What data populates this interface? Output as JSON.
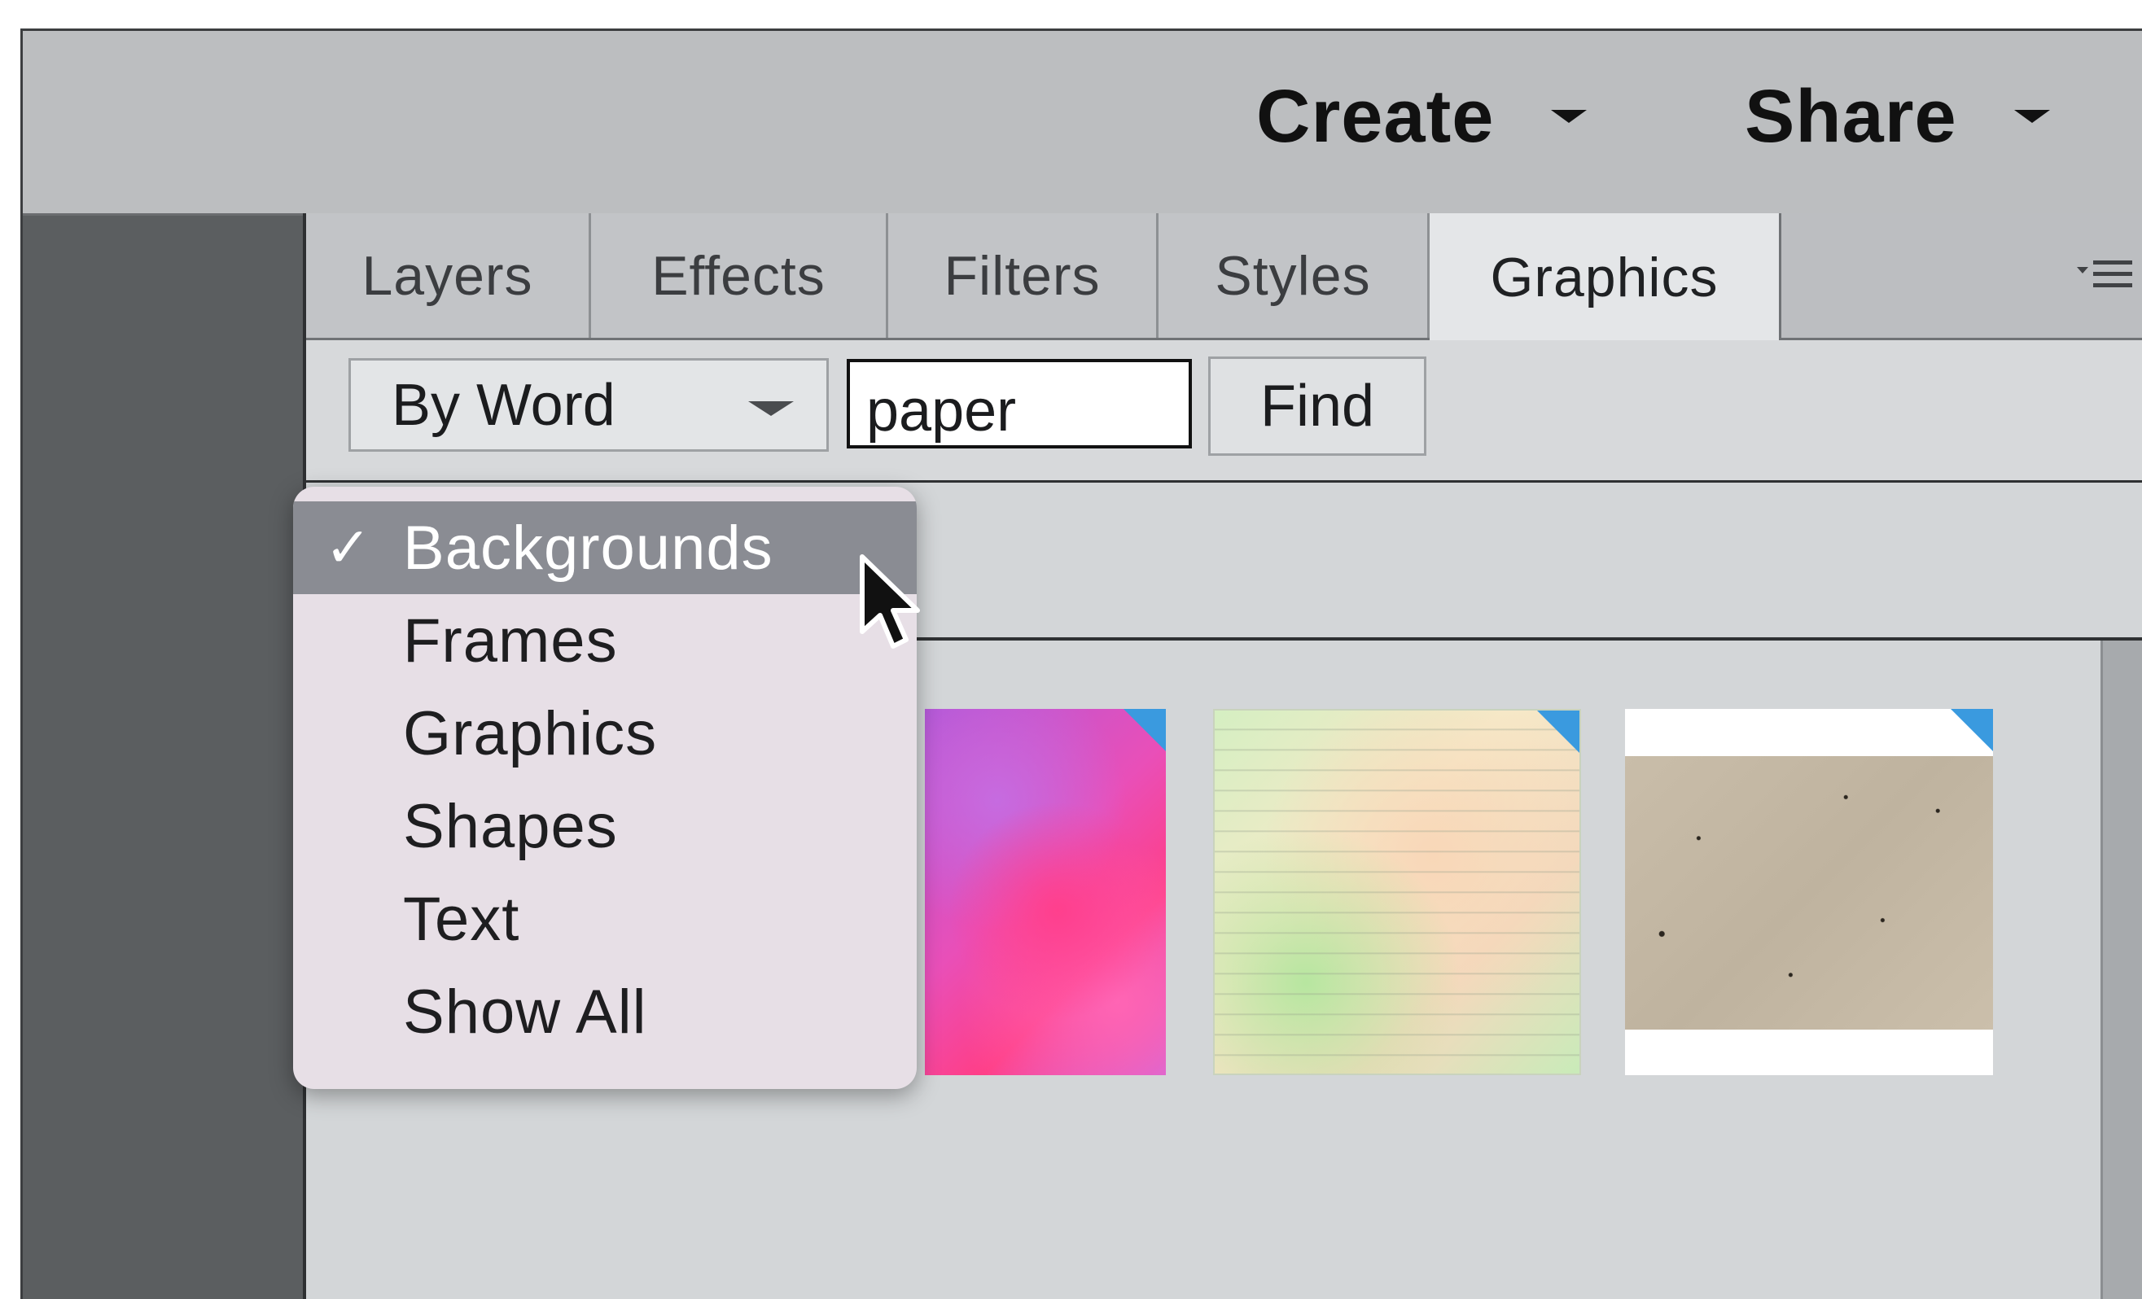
{
  "topbar": {
    "create_label": "Create",
    "share_label": "Share"
  },
  "tabs": [
    {
      "label": "Layers"
    },
    {
      "label": "Effects"
    },
    {
      "label": "Filters"
    },
    {
      "label": "Styles"
    },
    {
      "label": "Graphics",
      "active": true
    }
  ],
  "search": {
    "mode_label": "By Word",
    "query": "paper",
    "find_label": "Find"
  },
  "category_menu": {
    "items": [
      {
        "label": "Backgrounds",
        "checked": true
      },
      {
        "label": "Frames"
      },
      {
        "label": "Graphics"
      },
      {
        "label": "Shapes"
      },
      {
        "label": "Text"
      },
      {
        "label": "Show All"
      }
    ],
    "check_glyph": "✓"
  },
  "thumbnails": [
    {
      "name": "pink watercolor paper"
    },
    {
      "name": "lined pastel paper"
    },
    {
      "name": "speckled kraft paper"
    }
  ],
  "colors": {
    "accent_corner": "#3a9adf",
    "menu_highlight": "#8a8c93"
  },
  "icons": {
    "panel_menu": "panel-menu-icon",
    "cursor": "arrow-cursor-icon"
  }
}
